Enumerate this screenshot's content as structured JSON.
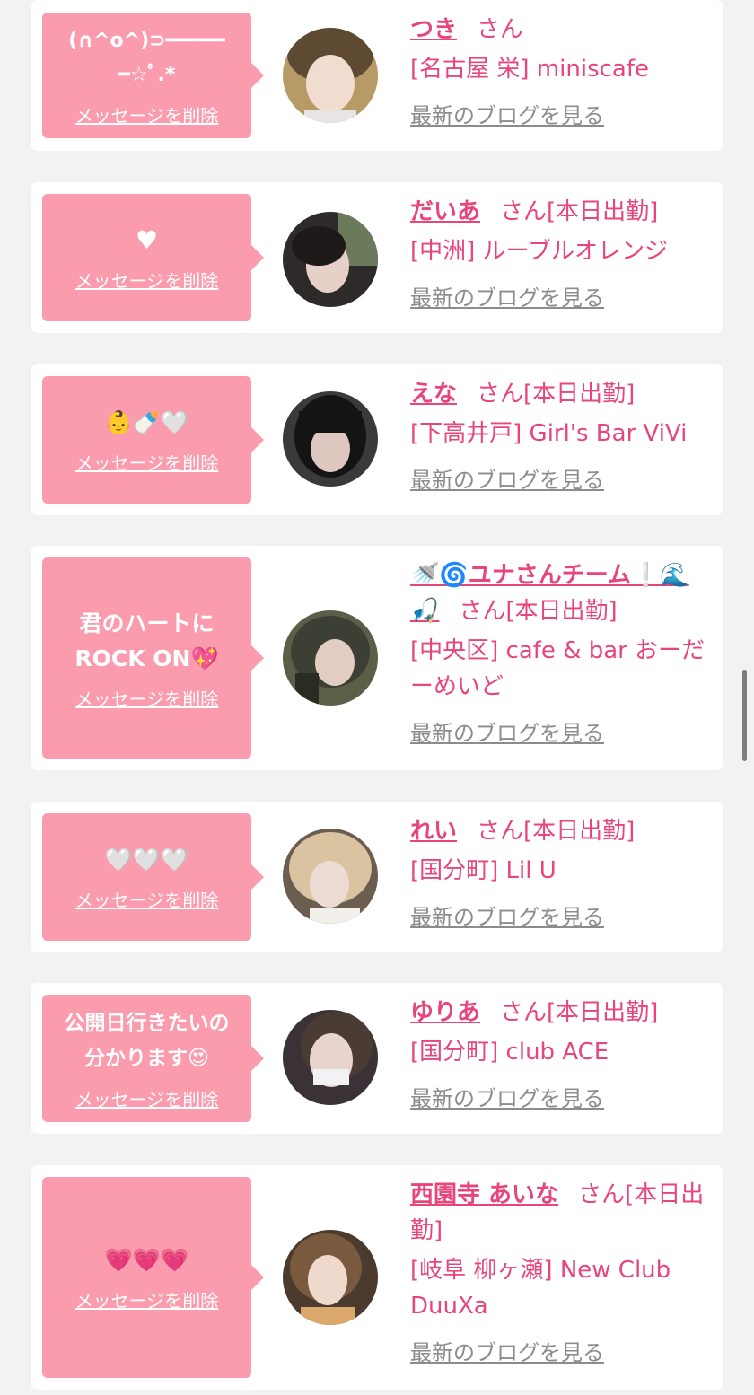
{
  "delete_label": "メッセージを削除",
  "blog_label": "最新のブログを見る",
  "honorific": "さん",
  "cards": [
    {
      "message": "(∩^o^)⊃━━━━━\n━☆ﾟ.*",
      "name": "つき",
      "status": "",
      "shop": "[名古屋 栄] miniscafe",
      "avatar_icon": "user-photo-icon"
    },
    {
      "message": "♥",
      "name": "だいあ",
      "status": "[本日出勤]",
      "shop": "[中洲] ルーブルオレンジ",
      "avatar_icon": "user-photo-icon"
    },
    {
      "message": "👶🍼🤍",
      "name": "えな",
      "status": "[本日出勤]",
      "shop": "[下高井戸] Girl's Bar ViVi",
      "avatar_icon": "user-photo-icon"
    },
    {
      "message": "君のハートに\nROCK ON💖",
      "name": "🚿🌀ユナさんチーム❕🌊🎣",
      "status": "[本日出勤]",
      "shop": "[中央区] cafe & bar おーだーめいど",
      "avatar_icon": "user-photo-icon"
    },
    {
      "message": "🤍🤍🤍",
      "name": "れい",
      "status": "[本日出勤]",
      "shop": "[国分町] Lil U",
      "avatar_icon": "user-photo-icon"
    },
    {
      "message": "公開日行きたいの\n分かります😍",
      "name": "ゆりあ",
      "status": "[本日出勤]",
      "shop": "[国分町] club ACE",
      "avatar_icon": "user-photo-icon"
    },
    {
      "message": "💗💗💗",
      "name": "西園寺 あいな",
      "status": "[本日出勤]",
      "shop": "[岐阜 柳ヶ瀬] New Club DuuXa",
      "avatar_icon": "user-photo-icon"
    }
  ]
}
